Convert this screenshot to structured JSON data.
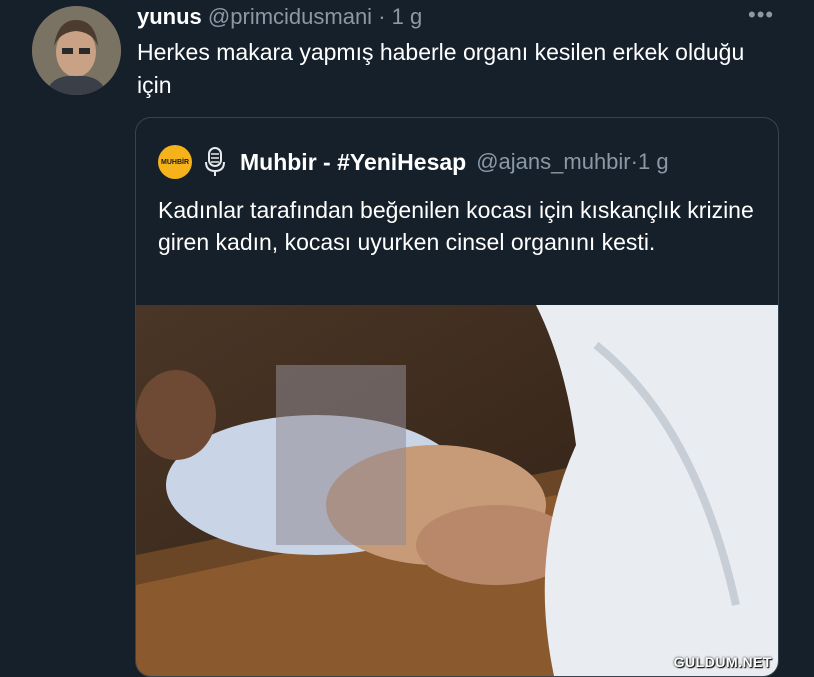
{
  "tweet": {
    "author_name": "yunus",
    "author_handle": "@primcidusmani",
    "separator": " · ",
    "time": "1 g",
    "more_icon": "more-horizontal-icon",
    "text": "Herkes makara yapmış haberle organı kesilen erkek olduğu için"
  },
  "quoted_tweet": {
    "avatar_text": "MUHBİR",
    "author_name": "Muhbir - #YeniHesap",
    "author_handle": "@ajans_muhbir",
    "separator": " · ",
    "time": "1 g",
    "text": "Kadınlar tarafından beğenilen kocası için kıskançlık krizine giren kadın, kocası uyurken cinsel organını kesti.",
    "media": "photo"
  },
  "watermark": "GULDUM.NET",
  "colors": {
    "background": "#15202b",
    "secondary_text": "#8b98a5",
    "border": "#38444d",
    "brand_avatar": "#f5b21a"
  }
}
